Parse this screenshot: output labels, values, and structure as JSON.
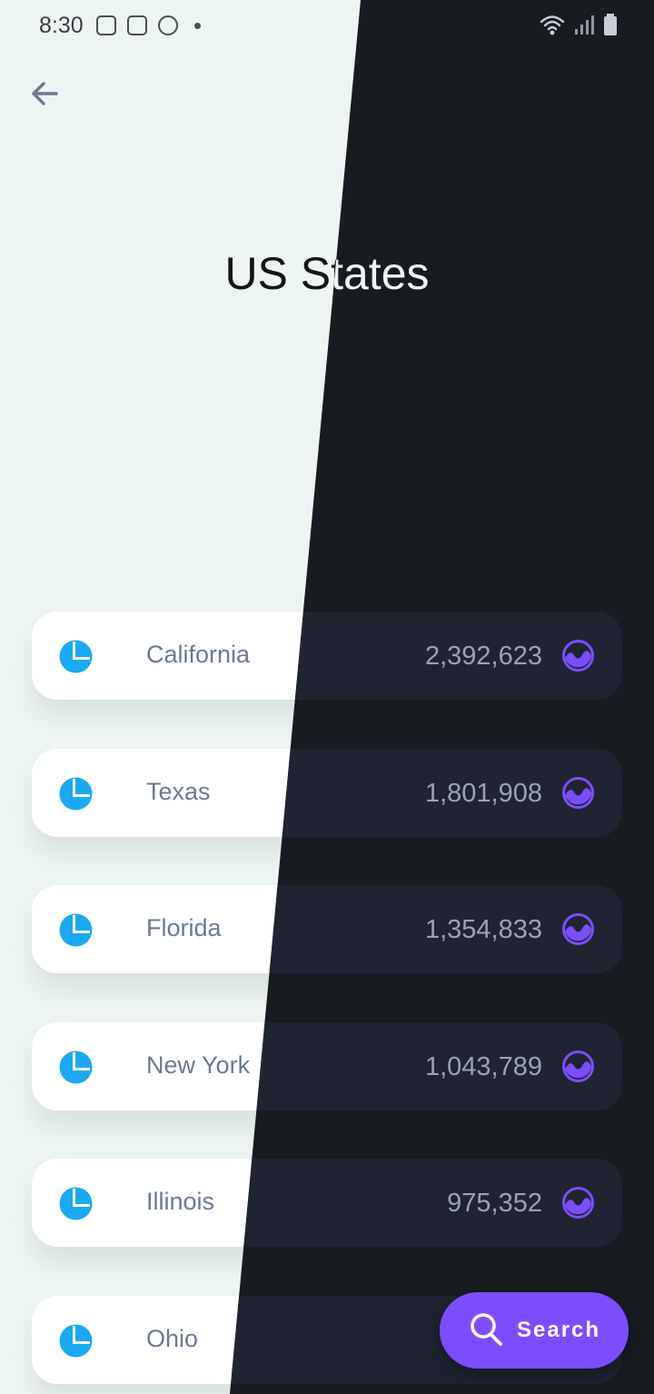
{
  "status_bar": {
    "time": "8:30"
  },
  "page": {
    "title": "US States"
  },
  "rows": [
    {
      "name": "California",
      "value": "2,392,623"
    },
    {
      "name": "Texas",
      "value": "1,801,908"
    },
    {
      "name": "Florida",
      "value": "1,354,833"
    },
    {
      "name": "New York",
      "value": "1,043,789"
    },
    {
      "name": "Illinois",
      "value": "975,352"
    },
    {
      "name": "Ohio",
      "value": ""
    }
  ],
  "fab": {
    "label": "Search",
    "icon": "search-icon"
  },
  "colors": {
    "light_bg": "#edf5f2",
    "dark_bg": "#181b20",
    "accent": "#7c4dff",
    "pie": "#1aa9f2",
    "wave": "#7c4dff"
  }
}
